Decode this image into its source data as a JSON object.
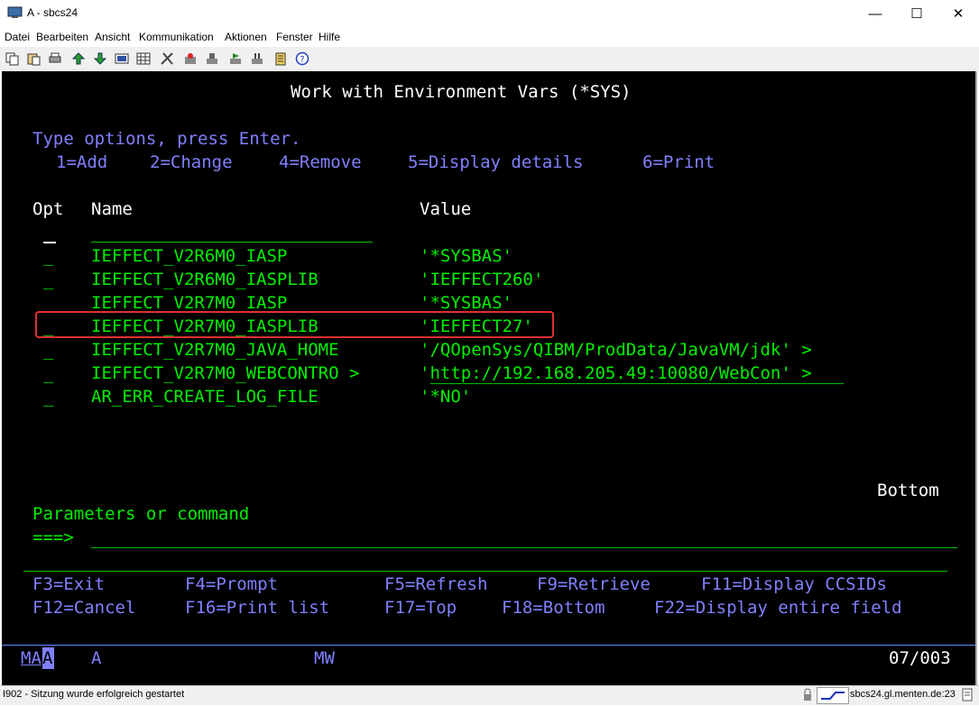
{
  "window": {
    "title": "A - sbcs24",
    "minimize": "—",
    "maximize": "☐",
    "close": "✕"
  },
  "menu": [
    "Datei",
    "Bearbeiten",
    "Ansicht",
    "Kommunikation",
    "Aktionen",
    "Fenster",
    "Hilfe"
  ],
  "toolbar_icons": [
    "copy-icon",
    "paste-icon",
    "print-icon",
    "send-file-icon",
    "receive-file-icon",
    "display-icon",
    "keypad-icon",
    "macro-icon",
    "record-icon",
    "stop-icon",
    "play-icon",
    "pause-icon",
    "notes-icon",
    "help-icon"
  ],
  "screen": {
    "title": "Work with Environment Vars (*SYS)",
    "instructions": "Type options, press Enter.",
    "options": [
      "1=Add",
      "2=Change",
      "4=Remove",
      "5=Display details",
      "6=Print"
    ],
    "headers": {
      "opt": "Opt",
      "name": "Name",
      "value": "Value"
    },
    "rows": [
      {
        "opt": "_",
        "name": "IEFFECT_V2R6M0_IASP",
        "value": "'*SYSBAS'"
      },
      {
        "opt": "_",
        "name": "IEFFECT_V2R6M0_IASPLIB",
        "value": "'IEFFECT260'"
      },
      {
        "opt": "_",
        "name": "IEFFECT_V2R7M0_IASP",
        "value": "'*SYSBAS'"
      },
      {
        "opt": "_",
        "name": "IEFFECT_V2R7M0_IASPLIB",
        "value": "'IEFFECT27'"
      },
      {
        "opt": "_",
        "name": "IEFFECT_V2R7M0_JAVA_HOME",
        "value": "'/QOpenSys/QIBM/ProdData/JavaVM/jdk' >"
      },
      {
        "opt": "_",
        "name": "IEFFECT_V2R7M0_WEBCONTRO >",
        "value": "'http://192.168.205.49:10080/WebCon' >"
      },
      {
        "opt": "_",
        "name": "AR_ERR_CREATE_LOG_FILE",
        "value": "'*NO'"
      }
    ],
    "bottom": "Bottom",
    "params_label": "Parameters or command",
    "prompt": "===>",
    "fkeys_row1": [
      "F3=Exit",
      "F4=Prompt",
      "F5=Refresh",
      "F9=Retrieve",
      "F11=Display CCSIDs"
    ],
    "fkeys_row2": [
      "F12=Cancel",
      "F16=Print list",
      "F17=Top",
      "F18=Bottom",
      "F22=Display entire field"
    ],
    "oia": {
      "left": "MA",
      "cursor": "A",
      "session": "A",
      "mw": "MW",
      "position": "07/003"
    }
  },
  "status": {
    "message": "I902 - Sitzung wurde erfolgreich gestartet",
    "host": "sbcs24.gl.menten.de:23"
  }
}
